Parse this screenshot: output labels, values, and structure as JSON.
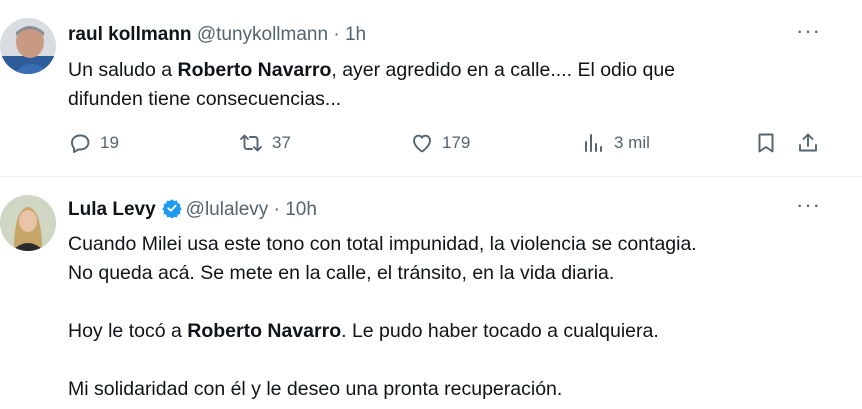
{
  "tweets": [
    {
      "display_name": "raul kollmann",
      "handle": "@tunykollmann",
      "separator": " · ",
      "time": "1h",
      "lines": [
        {
          "pre": "Un saludo a ",
          "bold": "Roberto Navarro",
          "post": ", ayer agredido en a calle.... El odio que"
        },
        {
          "pre": "difunden tiene consecuencias...",
          "bold": "",
          "post": ""
        }
      ],
      "actions": {
        "replies": "19",
        "reposts": "37",
        "likes": "179",
        "views": "3 mil"
      },
      "more_label": "···"
    },
    {
      "display_name": "Lula Levy",
      "handle": "@lulalevy",
      "separator": " · ",
      "time": "10h",
      "verified": true,
      "lines": [
        {
          "pre": "Cuando Milei usa este tono con total impunidad, la violencia se contagia.",
          "bold": "",
          "post": ""
        },
        {
          "pre": "No queda acá. Se mete en la calle, el tránsito, en la vida diaria.",
          "bold": "",
          "post": ""
        },
        {
          "pre": "Hoy le tocó a ",
          "bold": "Roberto Navarro",
          "post": ". Le pudo haber tocado a cualquiera."
        },
        {
          "pre": "Mi solidaridad con él y le deseo una pronta recuperación.",
          "bold": "",
          "post": ""
        }
      ],
      "more_label": "···"
    }
  ],
  "icons": {
    "reply": "reply-icon",
    "repost": "repost-icon",
    "like": "heart-icon",
    "views": "views-icon",
    "bookmark": "bookmark-icon",
    "share": "share-icon",
    "verified": "verified-badge-icon"
  },
  "colors": {
    "text": "#0f1419",
    "secondary": "#536471",
    "verified": "#1d9bf0",
    "divider": "#eff3f4"
  }
}
